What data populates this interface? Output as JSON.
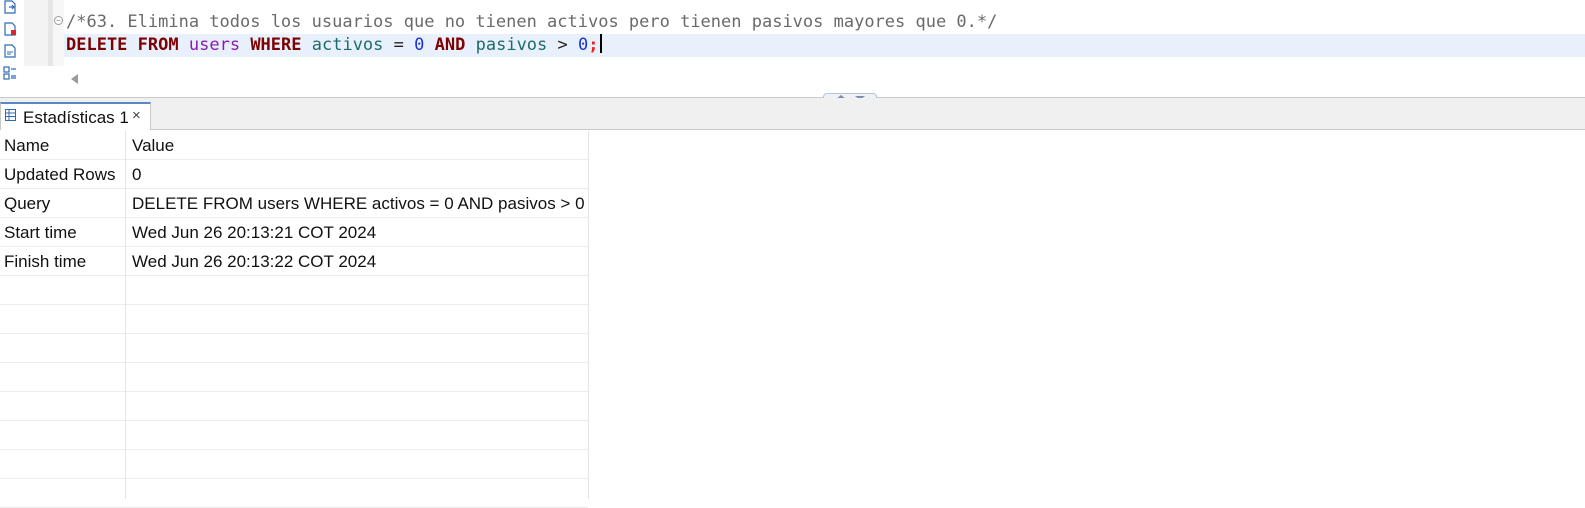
{
  "editor": {
    "comment_line": "/*63. Elimina todos los usuarios que no tienen activos pero tienen pasivos mayores que 0.*/",
    "sql_tokens": {
      "delete": "DELETE",
      "from": "FROM",
      "table": "users",
      "where": "WHERE",
      "col1": "activos",
      "eq": "=",
      "val1": "0",
      "and": "AND",
      "col2": "pasivos",
      "gt": ">",
      "val2": "0",
      "semicolon": ";"
    }
  },
  "results": {
    "tab_label": "Estadísticas 1",
    "tab_close": "×",
    "headers": {
      "name": "Name",
      "value": "Value"
    },
    "rows": [
      {
        "name": "Updated Rows",
        "value": "0"
      },
      {
        "name": "Query",
        "value": "DELETE FROM users WHERE activos = 0 AND pasivos > 0"
      },
      {
        "name": "Start time",
        "value": "Wed Jun 26 20:13:21 COT 2024"
      },
      {
        "name": "Finish time",
        "value": "Wed Jun 26 20:13:22 COT 2024"
      }
    ]
  },
  "colors": {
    "keyword": "#7f0000",
    "table": "#8b1ab5",
    "column": "#1e6b6b",
    "number": "#1a33d6",
    "current_line": "#e8f0fb",
    "tab_accent": "#5b87c7"
  }
}
